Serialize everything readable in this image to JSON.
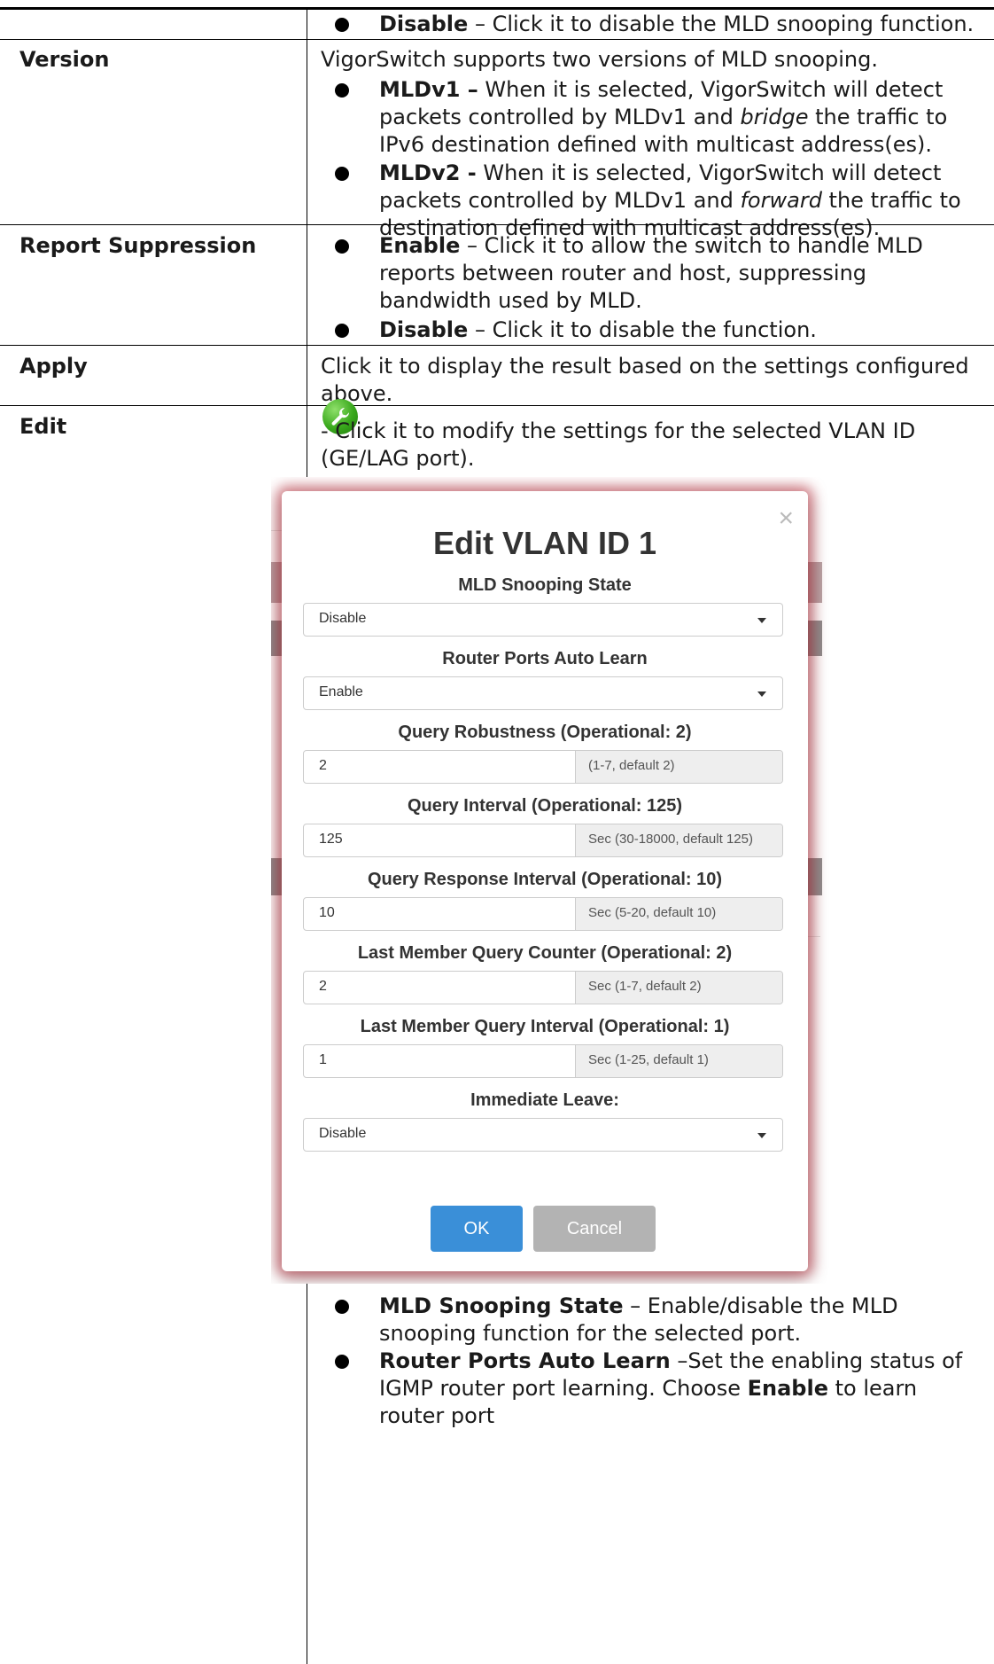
{
  "rows": {
    "mld_disable": {
      "term": "Disable",
      "desc": " – Click it to disable the MLD snooping function."
    },
    "version": {
      "label": "Version",
      "intro": "VigorSwitch supports two versions of MLD snooping.",
      "v1_term": "MLDv1 –",
      "v1_a": " When it is selected, VigorSwitch will detect packets controlled by MLDv1 and ",
      "v1_em": "bridge",
      "v1_b": " the traffic to IPv6 destination defined with multicast address(es).",
      "v2_term": "MLDv2 -",
      "v2_a": " When it is selected, VigorSwitch will detect packets controlled by MLDv1 and ",
      "v2_em": "forward",
      "v2_b": " the traffic to destination defined with multicast address(es)."
    },
    "report": {
      "label": "Report Suppression",
      "enable_term": "Enable",
      "enable_desc": " – Click it to allow the switch to handle MLD reports between router and host, suppressing bandwidth used by MLD.",
      "disable_term": "Disable",
      "disable_desc": " – Click it to disable the function."
    },
    "apply": {
      "label": "Apply",
      "desc": "Click it to display the result based on the settings configured above."
    },
    "edit": {
      "label": "Edit",
      "desc": "- Click it to modify the settings for the selected VLAN ID (GE/LAG port).",
      "icon": "wrench-icon",
      "b1_term": "MLD Snooping State",
      "b1_desc": " – Enable/disable the MLD snooping function for the selected port.",
      "b2_term": "Router Ports Auto Learn",
      "b2_desc_a": " –Set the enabling status of IGMP router port learning. Choose ",
      "b2_em": "Enable",
      "b2_desc_b": " to learn router port"
    }
  },
  "modal": {
    "close": "×",
    "title": "Edit VLAN ID 1",
    "snooping_state_label": "MLD Snooping State",
    "snooping_state_value": "Disable",
    "auto_learn_label": "Router Ports Auto Learn",
    "auto_learn_value": "Enable",
    "robustness_label": "Query Robustness (Operational: 2)",
    "robustness_value": "2",
    "robustness_hint": "(1-7, default 2)",
    "interval_label": "Query Interval (Operational: 125)",
    "interval_value": "125",
    "interval_hint": "Sec (30-18000, default 125)",
    "response_label": "Query Response Interval (Operational: 10)",
    "response_value": "10",
    "response_hint": "Sec (5-20, default 10)",
    "lmq_counter_label": "Last Member Query Counter (Operational: 2)",
    "lmq_counter_value": "2",
    "lmq_counter_hint": "Sec (1-7, default 2)",
    "lmq_interval_label": "Last Member Query Interval (Operational: 1)",
    "lmq_interval_value": "1",
    "lmq_interval_hint": "Sec (1-25, default 1)",
    "leave_label": "Immediate Leave:",
    "leave_value": "Disable",
    "ok": "OK",
    "cancel": "Cancel"
  },
  "colors": {
    "ok_button": "#3a8fd8",
    "cancel_button": "#b3b3b3",
    "modal_glow": "#be2837",
    "edit_icon": "#39a81c"
  }
}
